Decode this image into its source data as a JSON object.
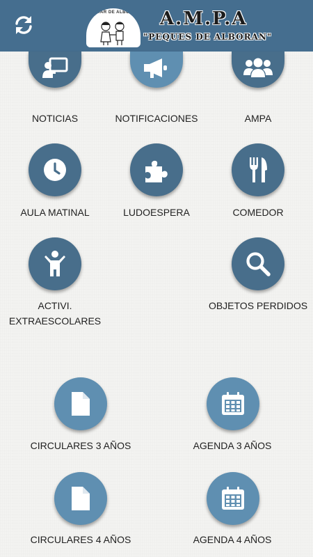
{
  "header": {
    "seal_text": "E.I. MAR DE ALBORAN",
    "title": "A.M.P.A",
    "subtitle": "\"PEQUES DE ALBORAN\""
  },
  "colors": {
    "header_bg": "#456e8f",
    "circle_dark": "#486e8b",
    "circle_light": "#5f8fb1"
  },
  "menu": {
    "noticias": {
      "label": "NOTICIAS",
      "icon": "presentation-icon"
    },
    "notificaciones": {
      "label": "NOTIFICACIONES",
      "icon": "megaphone-icon"
    },
    "ampa": {
      "label": "AMPA",
      "icon": "users-icon"
    },
    "aula_matinal": {
      "label": "AULA MATINAL",
      "icon": "clock-icon"
    },
    "ludoespera": {
      "label": "LUDOESPERA",
      "icon": "puzzle-icon"
    },
    "comedor": {
      "label": "COMEDOR",
      "icon": "utensils-icon"
    },
    "extraescolares": {
      "label": "ACTIVI. EXTRAESCOLARES",
      "icon": "child-icon"
    },
    "objetos_perdidos": {
      "label": "OBJETOS PERDIDOS",
      "icon": "search-icon"
    },
    "circulares_3": {
      "label": "CIRCULARES 3 AÑOS",
      "icon": "document-icon"
    },
    "agenda_3": {
      "label": "AGENDA 3 AÑOS",
      "icon": "calendar-icon"
    },
    "circulares_4": {
      "label": "CIRCULARES 4 AÑOS",
      "icon": "document-icon"
    },
    "agenda_4": {
      "label": "AGENDA 4 AÑOS",
      "icon": "calendar-icon"
    }
  }
}
